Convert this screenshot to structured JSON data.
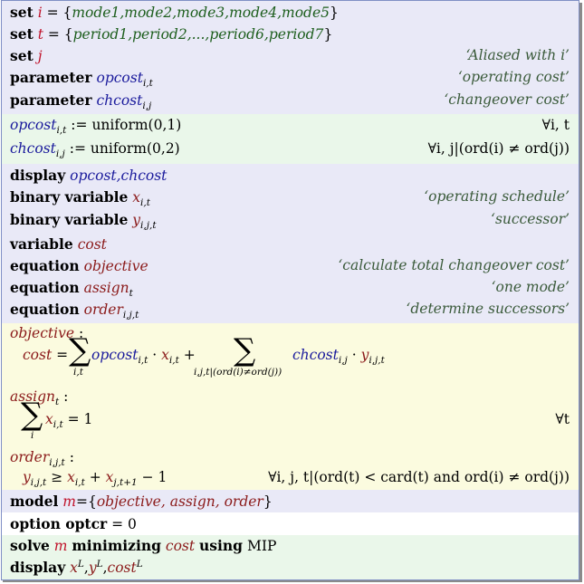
{
  "sets": {
    "i": {
      "name": "i",
      "elements": "mode1,mode2,mode3,mode4,mode5"
    },
    "t": {
      "name": "t",
      "elements": "period1,period2,...,period6,period7"
    },
    "j": {
      "name": "j",
      "comment": "‘Aliased with i’"
    }
  },
  "parameters": {
    "opcost": {
      "name": "opcost",
      "index": "i,t",
      "comment": "‘operating cost’"
    },
    "chcost": {
      "name": "chcost",
      "index": "i,j",
      "comment": "‘changeover cost’"
    }
  },
  "assignments": {
    "opcost_rhs": "uniform(0,1)",
    "opcost_domain": "∀i, t",
    "chcost_rhs": "uniform(0,2)",
    "chcost_domain": "∀i, j|(ord(i) ≠ ord(j))"
  },
  "display1": {
    "keyword": "display",
    "items": "opcost,chcost"
  },
  "variables": {
    "x": {
      "decl": "binary variable",
      "name": "x",
      "index": "i,t",
      "comment": "‘operating schedule’"
    },
    "y": {
      "decl": "binary variable",
      "name": "y",
      "index": "i,j,t",
      "comment": "‘successor’"
    },
    "cost": {
      "decl": "variable",
      "name": "cost"
    }
  },
  "equations": {
    "objective": {
      "name": "objective",
      "comment": "‘calculate total changeover cost’"
    },
    "assign": {
      "name": "assign",
      "index": "t",
      "comment": "‘one mode’"
    },
    "order": {
      "name": "order",
      "index": "i,j,t",
      "comment": "‘determine successors’"
    }
  },
  "definitions": {
    "objective_lhs": "cost",
    "objective_sum1_under": "i,t",
    "objective_sum2_under": "i,j,t|(ord(i)≠ord(j))",
    "assign_sum_under": "i",
    "assign_rhs": "1",
    "assign_domain": "∀t",
    "order_rhs": "− 1",
    "order_domain": "∀i, j, t|(ord(t) < card(t) and ord(i) ≠ ord(j))"
  },
  "model": {
    "keyword": "model",
    "name": "m",
    "members": "objective, assign, order"
  },
  "option": {
    "keyword": "option optcr",
    "value": "0"
  },
  "solve": {
    "keyword": "solve",
    "model": "m",
    "sense": "minimizing",
    "objective": "cost",
    "using": "using",
    "type": "MIP"
  },
  "display2": {
    "keyword": "display",
    "x": "x",
    "y": "y",
    "cost": "cost",
    "sup": "L"
  }
}
